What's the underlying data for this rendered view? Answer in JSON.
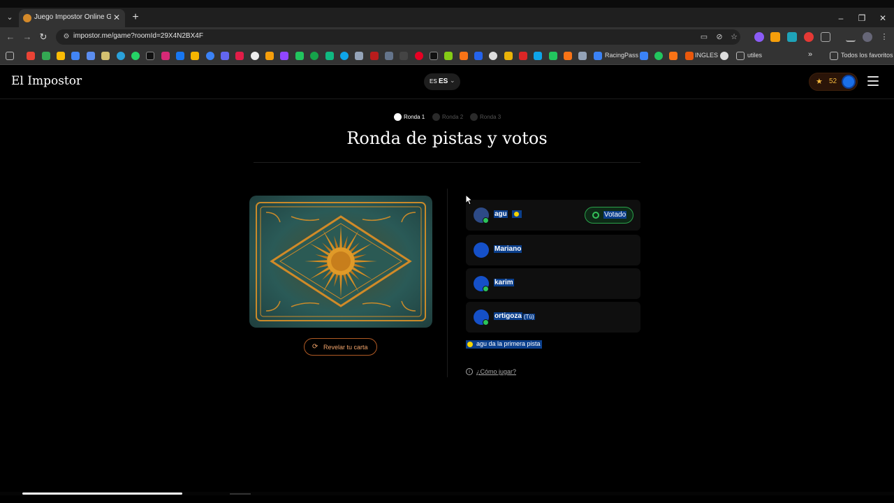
{
  "browser": {
    "tab_title": "Juego Impostor Online Gratis -",
    "url": "impostor.me/game?roomId=29X4N2BX4F",
    "tab_close": "✕",
    "new_tab": "+",
    "bookmarks": {
      "racingpass": "RacingPass",
      "ingles": "INGLES",
      "utiles": "utiles",
      "overflow": "»",
      "all_favorites": "Todos los favoritos"
    },
    "accent_color": "#333333"
  },
  "site": {
    "logo": "El Impostor",
    "language": {
      "flag": "ES",
      "code": "ES"
    },
    "score": "52",
    "accent_color": "#f5b83c"
  },
  "rounds": [
    {
      "label": "Ronda 1",
      "active": true
    },
    {
      "label": "Ronda 2",
      "active": false
    },
    {
      "label": "Ronda 3",
      "active": false
    }
  ],
  "title": "Ronda de pistas y votos",
  "card": {
    "reveal_button": "Revelar tu carta",
    "art": "sun-card"
  },
  "players": [
    {
      "name": "agu",
      "first_clue_marker": true,
      "status": "Votado",
      "online": true
    },
    {
      "name": "Mariano",
      "online": false
    },
    {
      "name": "karim",
      "online": true
    },
    {
      "name": "ortigoza",
      "you_label": "(Tú)",
      "online": true
    }
  ],
  "first_clue_note": "agu da la primera pista",
  "how_to_play": "¿Cómo jugar?",
  "colors": {
    "voted_border": "#2aa24a",
    "online_badge": "#2bc45a",
    "reveal_border": "#b05a24",
    "selection_highlight": "#0b3f8c"
  }
}
